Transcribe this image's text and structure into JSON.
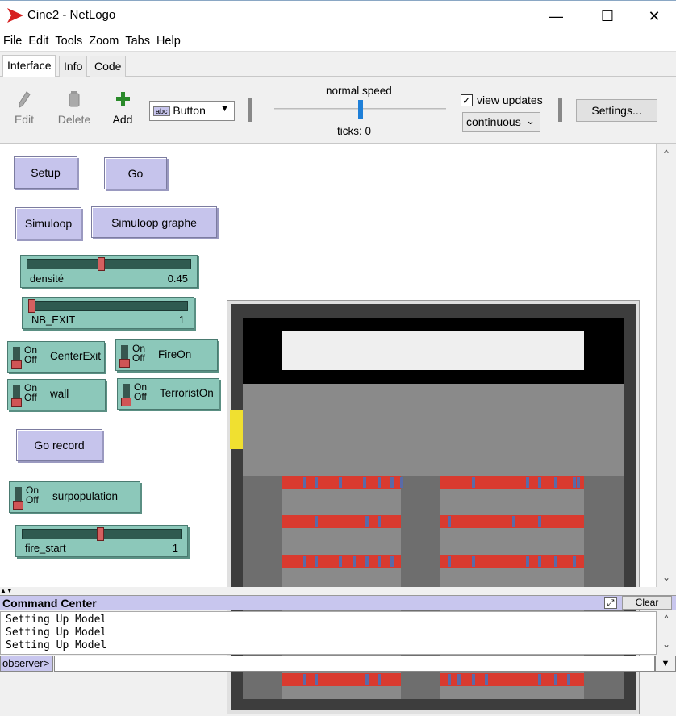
{
  "window": {
    "title": "Cine2 - NetLogo",
    "minimize": "—",
    "maximize": "☐",
    "close": "✕"
  },
  "menu": [
    "File",
    "Edit",
    "Tools",
    "Zoom",
    "Tabs",
    "Help"
  ],
  "tabs": [
    "Interface",
    "Info",
    "Code"
  ],
  "toolbar": {
    "edit": "Edit",
    "delete": "Delete",
    "add": "Add",
    "widget_type": "Button",
    "widget_badge": "abc",
    "speed_label": "normal speed",
    "speed_level": 0.5,
    "ticks_label": "ticks: 0",
    "view_updates_label": "view updates",
    "view_updates_checked": true,
    "update_mode": "continuous",
    "settings": "Settings..."
  },
  "widgets": {
    "setup": "Setup",
    "go": "Go",
    "simuloop": "Simuloop",
    "simuloop_graphe": "Simuloop graphe",
    "go_record": "Go record",
    "densite": {
      "name": "densité",
      "value": "0.45",
      "level": 0.45
    },
    "nb_exit": {
      "name": "NB_EXIT",
      "value": "1",
      "level": 0.0
    },
    "fire_start": {
      "name": "fire_start",
      "value": "1",
      "level": 0.49
    },
    "switches": {
      "on": "On",
      "off": "Off",
      "center_exit": "CenterExit",
      "fire_on": "FireOn",
      "wall": "wall",
      "terrorist_on": "TerroristOn",
      "surpopulation": "surpopulation"
    }
  },
  "command_center": {
    "title": "Command Center",
    "clear": "Clear",
    "output": [
      "Setting Up Model",
      "Setting Up Model",
      "Setting Up Model"
    ],
    "observer_label": "observer>"
  },
  "colors": {
    "button": "#c6c4ec",
    "slider": "#8cc8ba",
    "seat_row": "#d93a2f",
    "agent": "#5a6aa8",
    "exit": "#f0e030"
  }
}
